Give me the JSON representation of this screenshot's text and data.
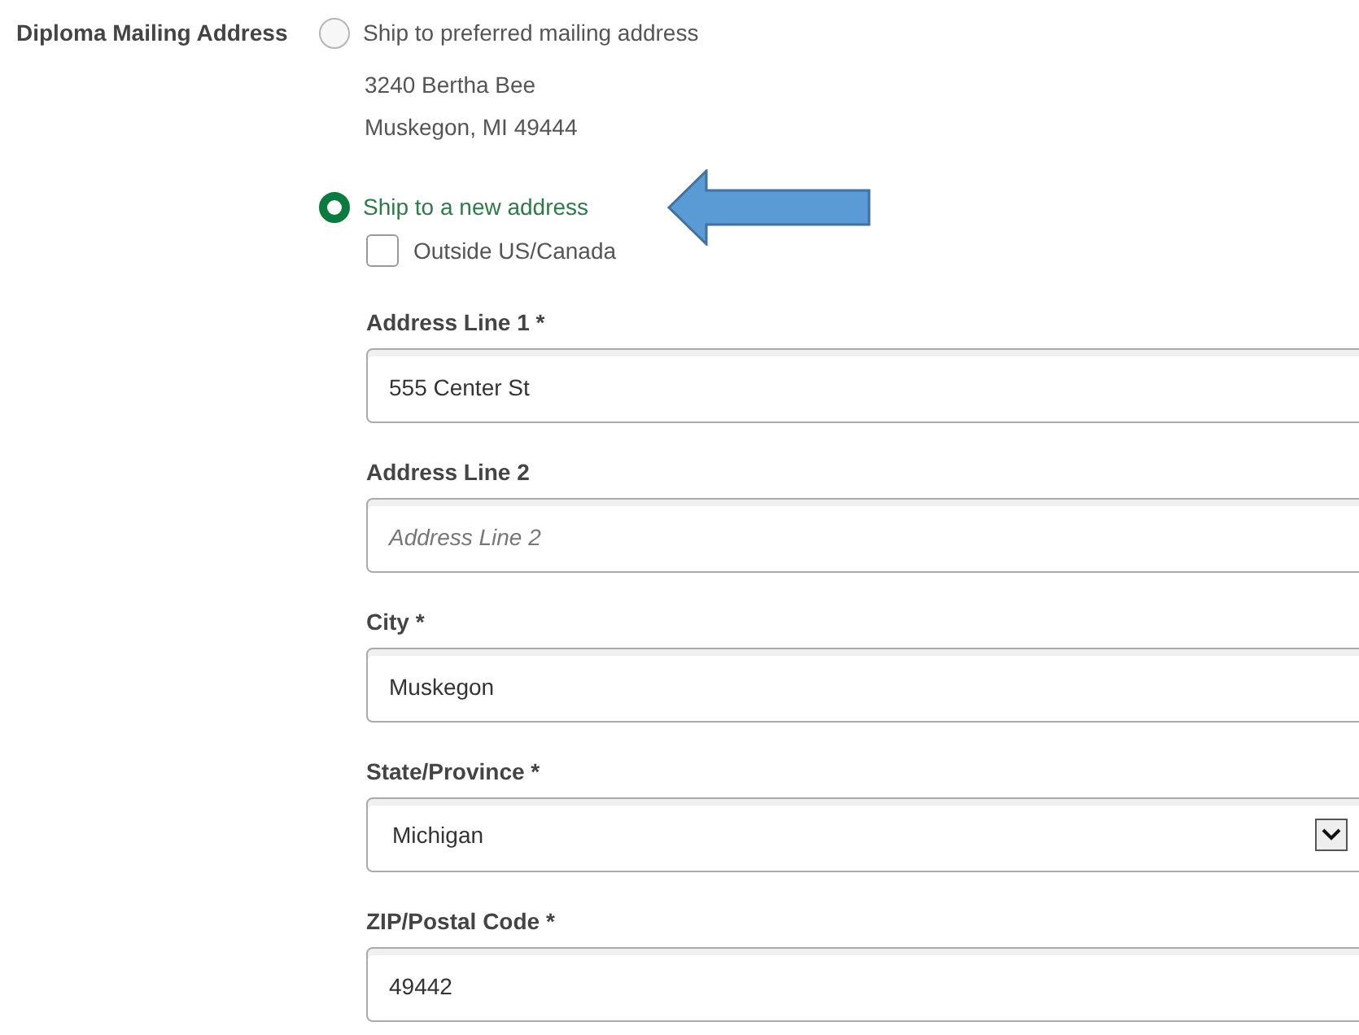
{
  "field_label": "Diploma Mailing Address",
  "options": [
    {
      "label": "Ship to preferred mailing address",
      "selected": false,
      "address_lines": [
        "3240 Bertha Bee",
        "Muskegon, MI 49444"
      ]
    },
    {
      "label": "Ship to a new address",
      "selected": true
    }
  ],
  "outside_checkbox": {
    "label": "Outside US/Canada",
    "checked": false
  },
  "fields": [
    {
      "kind": "text",
      "label": "Address Line 1 *",
      "value": "555 Center St"
    },
    {
      "kind": "text",
      "label": "Address Line 2",
      "placeholder": "Address Line 2"
    },
    {
      "kind": "text",
      "label": "City *",
      "value": "Muskegon"
    },
    {
      "kind": "select",
      "label": "State/Province *",
      "value": "Michigan"
    },
    {
      "kind": "text",
      "label": "ZIP/Postal Code *",
      "value": "49442"
    }
  ]
}
